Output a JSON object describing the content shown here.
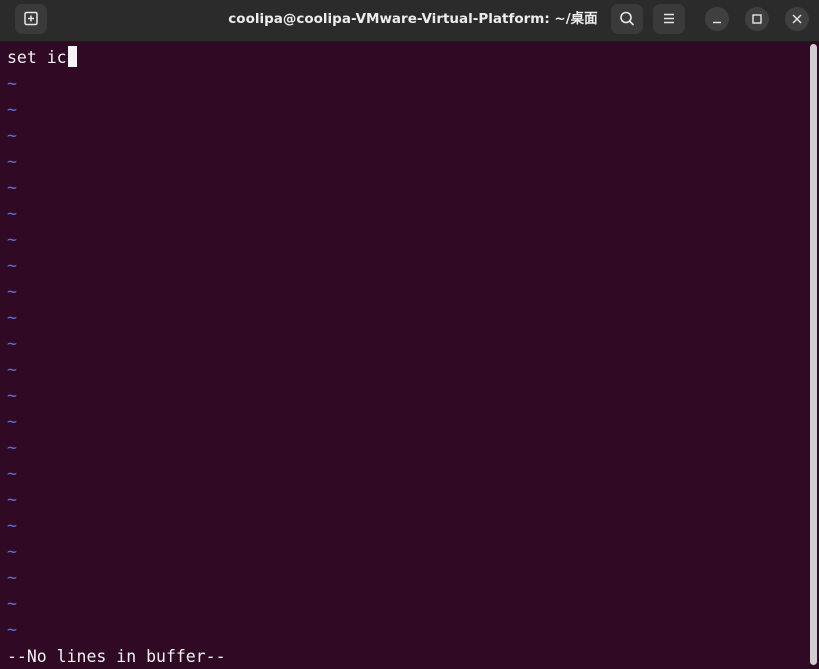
{
  "titlebar": {
    "title": "coolipa@coolipa-VMware-Virtual-Platform: ~/桌面",
    "icons": {
      "new_tab": "new-tab-icon",
      "search": "search-icon",
      "menu": "hamburger-menu-icon",
      "minimize": "minimize-icon",
      "maximize": "maximize-icon",
      "close": "close-icon"
    }
  },
  "editor": {
    "first_line": "set ic",
    "empty_line_marker": "~",
    "empty_line_count": 22,
    "status_line": "--No lines in buffer--"
  },
  "colors": {
    "terminal_background": "#300a24",
    "titlebar_background": "#2b2b2b",
    "tilde": "#5a6fd8",
    "text": "#f2f2f2"
  }
}
